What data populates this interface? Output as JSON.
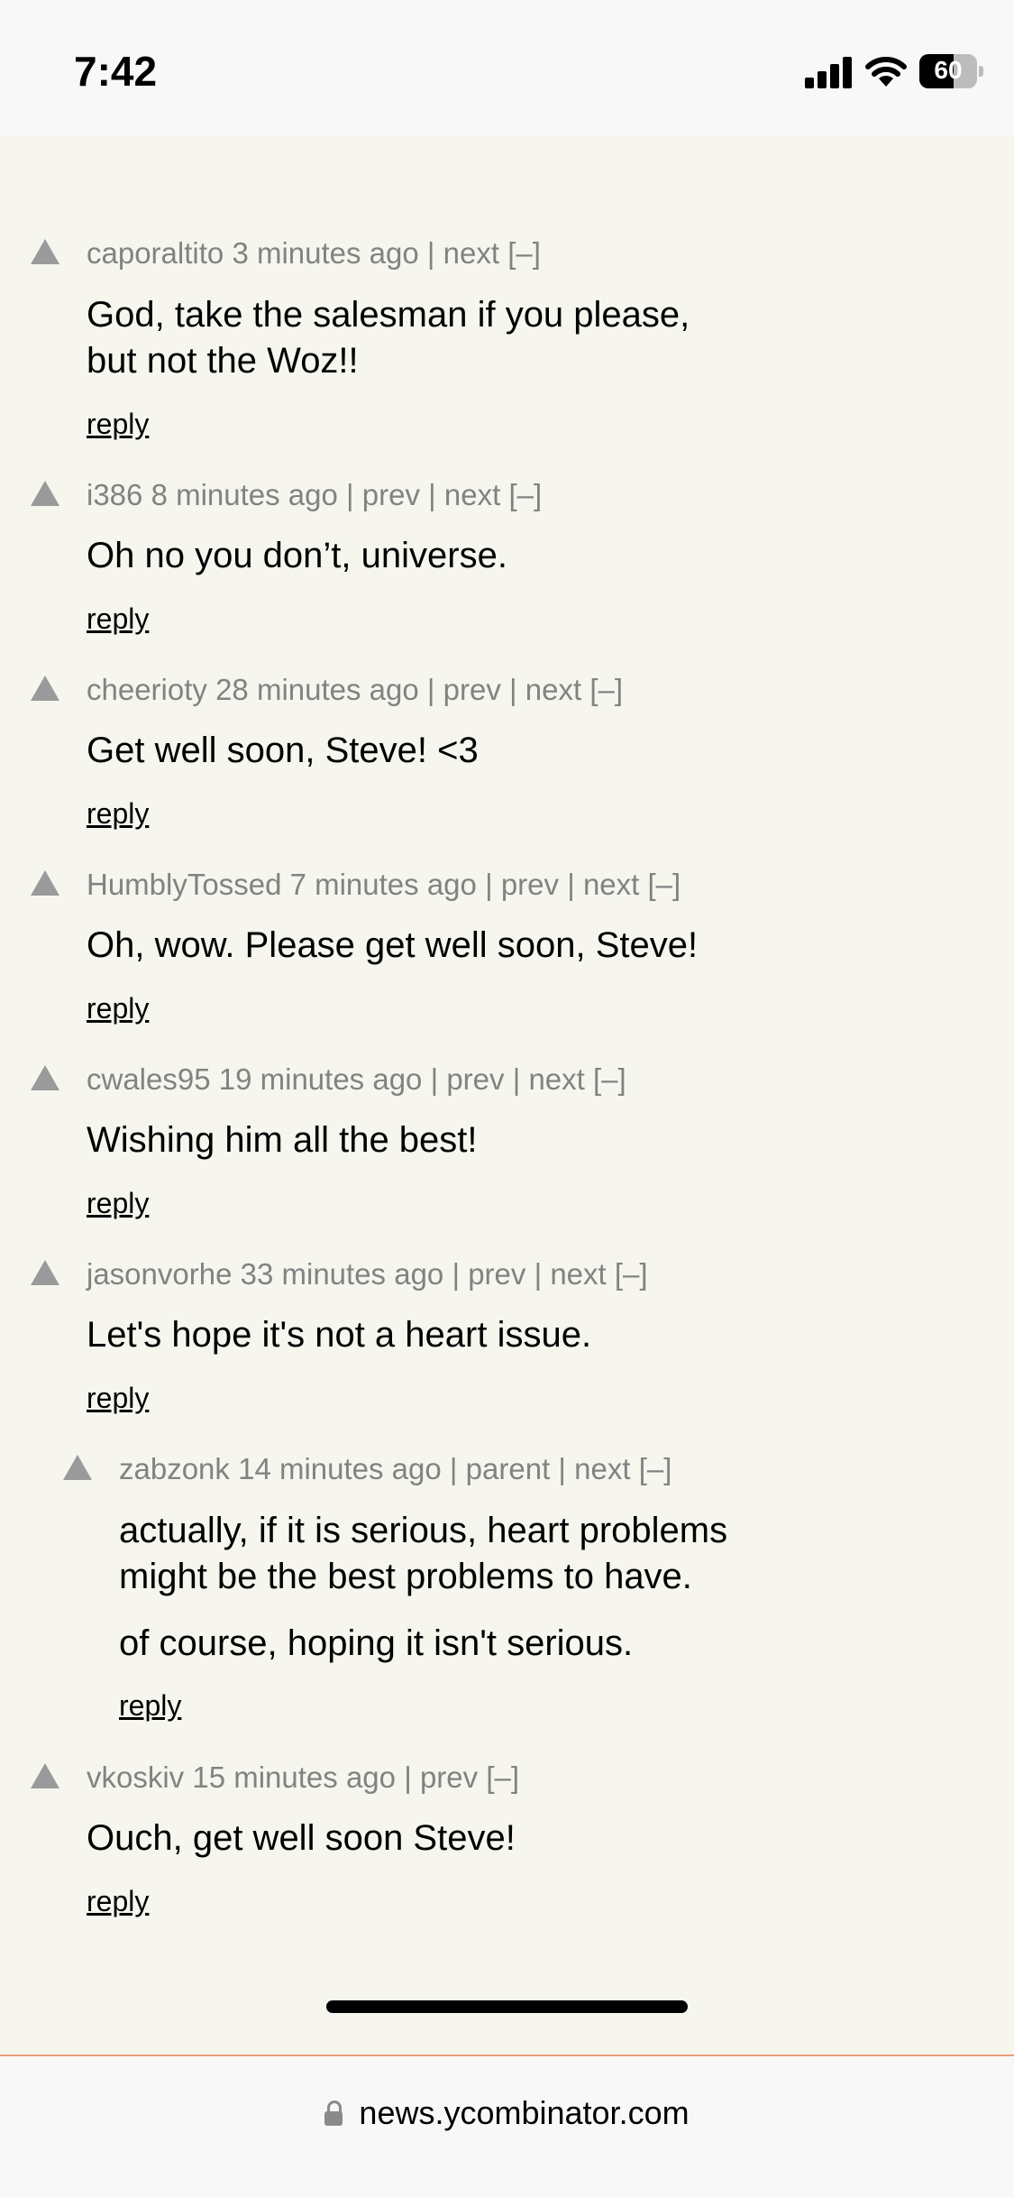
{
  "status_bar": {
    "time": "7:42",
    "battery": "60",
    "battery_level": 0.6,
    "icons": [
      "signal-icon",
      "wifi-icon",
      "battery-icon"
    ]
  },
  "comments": [
    {
      "user": "caporaltito",
      "age": "3 minutes ago",
      "links": [
        "next"
      ],
      "toggle": "[–]",
      "text": [
        "God, take the salesman if you please,",
        "but not the Woz!!"
      ],
      "reply": "reply"
    },
    {
      "user": "i386",
      "age": "8 minutes ago",
      "links": [
        "prev",
        "next"
      ],
      "toggle": "[–]",
      "text": [
        "Oh no you don’t, universe."
      ],
      "reply": "reply"
    },
    {
      "user": "cheerioty",
      "age": "28 minutes ago",
      "links": [
        "prev",
        "next"
      ],
      "toggle": "[–]",
      "text": [
        "Get well soon, Steve! <3"
      ],
      "reply": "reply"
    },
    {
      "user": "HumblyTossed",
      "age": "7 minutes ago",
      "links": [
        "prev",
        "next"
      ],
      "toggle": "[–]",
      "text": [
        "Oh, wow. Please get well soon, Steve!"
      ],
      "reply": "reply"
    },
    {
      "user": "cwales95",
      "age": "19 minutes ago",
      "links": [
        "prev",
        "next"
      ],
      "toggle": "[–]",
      "text": [
        "Wishing him all the best!"
      ],
      "reply": "reply"
    },
    {
      "user": "jasonvorhe",
      "age": "33 minutes ago",
      "links": [
        "prev",
        "next"
      ],
      "toggle": "[–]",
      "text": [
        "Let's hope it's not a heart issue."
      ],
      "reply": "reply"
    },
    {
      "user": "zabzonk",
      "age": "14 minutes ago",
      "links": [
        "parent",
        "next"
      ],
      "toggle": "[–]",
      "text": [
        "actually, if it is serious, heart problems",
        "might be the best problems to have.",
        "of course, hoping it isn't serious."
      ],
      "reply": "reply"
    },
    {
      "user": "vkoskiv",
      "age": "15 minutes ago",
      "links": [
        "prev"
      ],
      "toggle": "[–]",
      "text": [
        "Ouch, get well soon Steve!"
      ],
      "reply": "reply"
    }
  ],
  "url_bar": {
    "domain": "news.ycombinator.com"
  }
}
